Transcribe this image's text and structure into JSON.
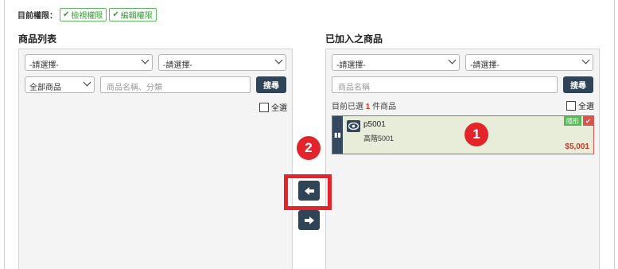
{
  "permissions": {
    "label": "目前權限：",
    "tags": [
      "檢視權限",
      "編輯權限"
    ]
  },
  "left_panel": {
    "title": "商品列表",
    "select1": "-請選擇-",
    "select2": "-請選擇-",
    "category_select": "全部商品",
    "search_placeholder": "商品名稱、分類",
    "search_button": "搜尋",
    "select_all": "全選"
  },
  "right_panel": {
    "title": "已加入之商品",
    "select1": "-請選擇-",
    "select2": "-請選擇-",
    "search_placeholder": "商品名稱",
    "search_button": "搜尋",
    "count_prefix": "目前已選",
    "count": "1",
    "count_suffix": "件商品",
    "select_all": "全選",
    "items": [
      {
        "code": "p5001",
        "name": "高階5001",
        "price": "$5,001",
        "badge": "隱形"
      }
    ]
  },
  "markers": {
    "one": "1",
    "two": "2"
  },
  "colors": {
    "dark_button": "#2f4457",
    "marker_red": "#e3242b",
    "tag_green": "#5cb85c",
    "price_red": "#c0392b"
  }
}
